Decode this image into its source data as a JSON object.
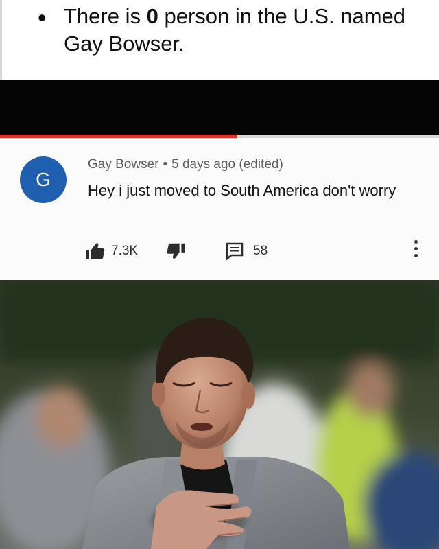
{
  "caption": {
    "bullet": "•",
    "line_prefix": "There is ",
    "count": "0",
    "line_suffix": " person in the U.S. named Gay Bowser."
  },
  "video": {
    "progress_fraction": 0.54,
    "progress_color": "#e0312b"
  },
  "comment": {
    "avatar_letter": "G",
    "avatar_color": "#1f5fb0",
    "author": "Gay Bowser",
    "separator": "•",
    "time": "5 days ago (edited)",
    "text": "Hey i just moved to South America don't worry",
    "likes": "7.3K",
    "replies": "58",
    "icons": [
      "thumbs-up-icon",
      "thumbs-down-icon",
      "comment-icon",
      "more-vertical-icon"
    ]
  }
}
